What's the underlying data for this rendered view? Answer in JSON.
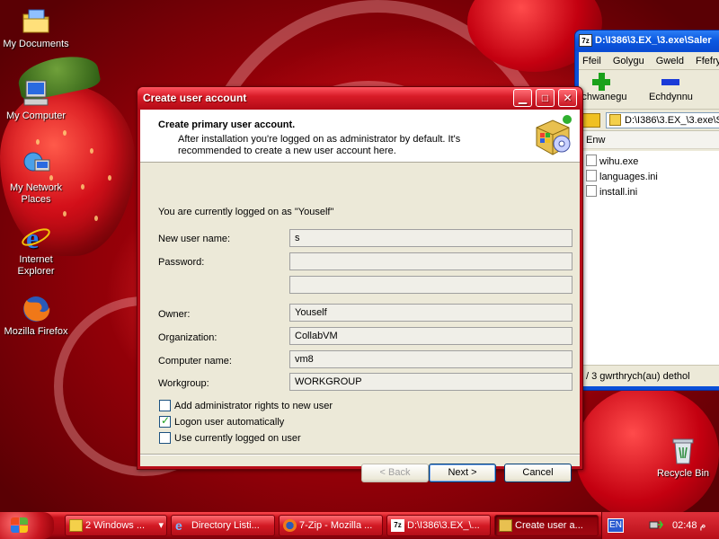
{
  "desktop": {
    "icons": [
      {
        "label": "My Documents",
        "icon": "folder-documents-icon"
      },
      {
        "label": "My Computer",
        "icon": "computer-icon"
      },
      {
        "label": "My Network Places",
        "icon": "network-icon"
      },
      {
        "label": "Internet Explorer",
        "icon": "internet-explorer-icon"
      },
      {
        "label": "Mozilla Firefox",
        "icon": "firefox-icon"
      },
      {
        "label": "Recycle Bin",
        "icon": "recycle-bin-icon"
      }
    ]
  },
  "explorer": {
    "title": "D:\\I386\\3.EX_\\3.exe\\Saler",
    "title_icon": "7z",
    "menu": [
      "Ffeil",
      "Golygu",
      "Gweld",
      "Ffefry"
    ],
    "toolbar": {
      "add_label": "Ychwanegu",
      "remove_label": "Echdynnu"
    },
    "address": "D:\\I386\\3.EX_\\3.exe\\S",
    "column_header": "Enw",
    "files": [
      "wihu.exe",
      "languages.ini",
      "install.ini"
    ],
    "status": "/ 3 gwrthrych(au) dethol"
  },
  "dialog": {
    "title": "Create user account",
    "header_title": "Create primary user account.",
    "header_subtitle": "After installation you're logged on as administrator by default. It's recommended to create a new user account here.",
    "logged_on_text": "You are currently logged on as \"Youself\"",
    "fields": {
      "new_user_name": {
        "label": "New user name:",
        "value": "s"
      },
      "password": {
        "label": "Password:",
        "value": ""
      },
      "password_confirm": {
        "value": ""
      },
      "owner": {
        "label": "Owner:",
        "value": "Youself"
      },
      "organization": {
        "label": "Organization:",
        "value": "CollabVM"
      },
      "computer_name": {
        "label": "Computer name:",
        "value": "vm8"
      },
      "workgroup": {
        "label": "Workgroup:",
        "value": "WORKGROUP"
      }
    },
    "checkboxes": [
      {
        "label": "Add administrator rights to new user",
        "checked": false
      },
      {
        "label": "Logon user automatically",
        "checked": true
      },
      {
        "label": "Use currently logged on user",
        "checked": false
      }
    ],
    "buttons": {
      "back": "< Back",
      "next": "Next >",
      "cancel": "Cancel"
    }
  },
  "taskbar": {
    "items": [
      {
        "label": "2 Windows ...",
        "count": "2",
        "text": "Windows ..."
      },
      {
        "label": "Directory Listi..."
      },
      {
        "label": "7-Zip - Mozilla ..."
      },
      {
        "label": "D:\\I386\\3.EX_\\..."
      },
      {
        "label": "Create user a..."
      }
    ],
    "tray": {
      "language": "EN",
      "clock": "02:48 م"
    }
  },
  "colors": {
    "accent": "#c8101c",
    "title_red": "#d81c28",
    "dialog_bg": "#ece9d8"
  }
}
